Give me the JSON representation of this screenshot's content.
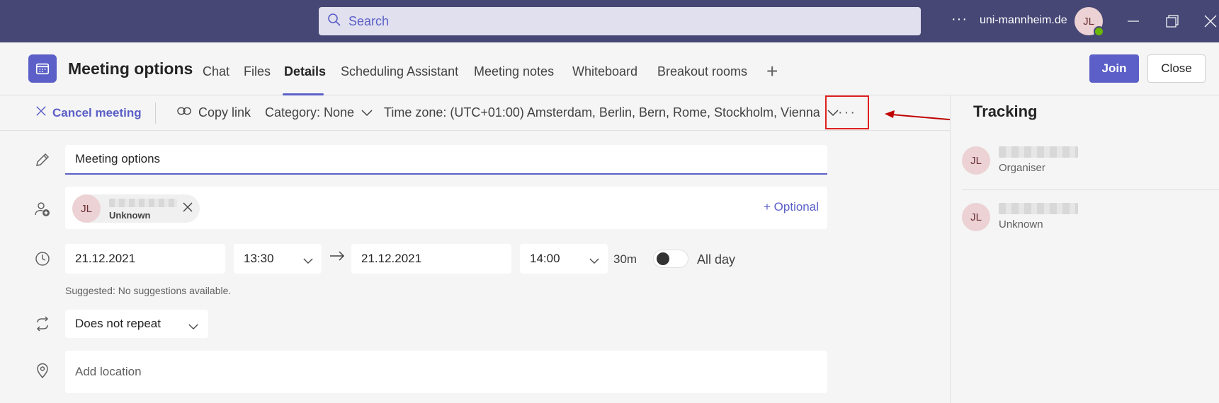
{
  "titlebar": {
    "search_placeholder": "Search",
    "more_label": "···",
    "org_name": "uni-mannheim.de",
    "avatar_initials": "JL"
  },
  "header": {
    "title": "Meeting options",
    "tabs": [
      {
        "label": "Chat"
      },
      {
        "label": "Files"
      },
      {
        "label": "Details"
      },
      {
        "label": "Scheduling Assistant"
      },
      {
        "label": "Meeting notes"
      },
      {
        "label": "Whiteboard"
      },
      {
        "label": "Breakout rooms"
      }
    ],
    "active_tab": "Details",
    "join_label": "Join",
    "close_label": "Close"
  },
  "command_bar": {
    "cancel_label": "Cancel meeting",
    "copy_link_label": "Copy link",
    "category_label": "Category: None",
    "timezone_label": "Time zone: (UTC+01:00) Amsterdam, Berlin, Bern, Rome, Stockholm, Vienna",
    "more_label": "···"
  },
  "form": {
    "title_value": "Meeting options",
    "attendee": {
      "initials": "JL",
      "status": "Unknown"
    },
    "optional_label": "+ Optional",
    "start_date": "21.12.2021",
    "start_time": "13:30",
    "end_date": "21.12.2021",
    "end_time": "14:00",
    "duration": "30m",
    "all_day_label": "All day",
    "all_day_on": false,
    "suggested_text": "Suggested: No suggestions available.",
    "repeat_value": "Does not repeat",
    "location_placeholder": "Add location"
  },
  "tracking": {
    "title": "Tracking",
    "rows": [
      {
        "initials": "JL",
        "role": "Organiser"
      },
      {
        "initials": "JL",
        "role": "Unknown"
      }
    ]
  },
  "colors": {
    "titlebar": "#464775",
    "brand": "#5b5fc7",
    "annotation_red": "#e02020"
  }
}
